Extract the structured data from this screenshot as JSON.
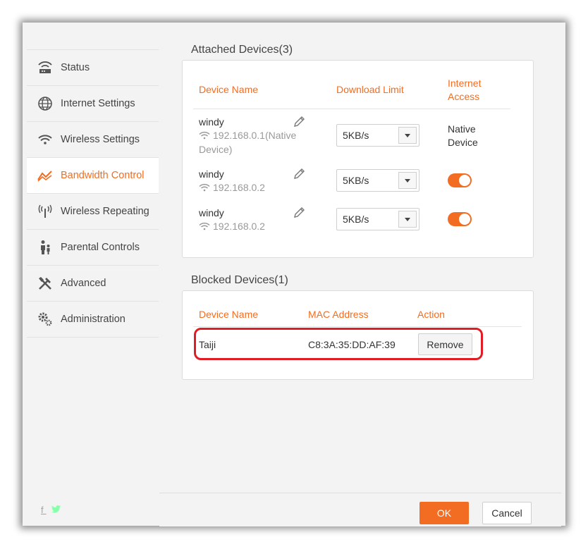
{
  "sidebar": {
    "items": [
      {
        "label": "Status",
        "icon": "router-icon"
      },
      {
        "label": "Internet Settings",
        "icon": "globe-icon"
      },
      {
        "label": "Wireless Settings",
        "icon": "wifi-icon"
      },
      {
        "label": "Bandwidth Control",
        "icon": "bandwidth-chart-icon",
        "active": true
      },
      {
        "label": "Wireless Repeating",
        "icon": "antenna-icon"
      },
      {
        "label": "Parental Controls",
        "icon": "family-icon"
      },
      {
        "label": "Advanced",
        "icon": "tools-icon"
      },
      {
        "label": "Administration",
        "icon": "gears-icon"
      }
    ],
    "social": [
      "facebook-icon",
      "twitter-icon"
    ],
    "social_text": "f"
  },
  "attached": {
    "title": "Attached Devices(3)",
    "headers": {
      "device_name": "Device Name",
      "download_limit": "Download Limit",
      "internet_access_1": "Internet",
      "internet_access_2": "Access"
    },
    "devices": [
      {
        "name": "windy",
        "ip_line1": "192.168.0.1(Native",
        "ip_line2": "Device)",
        "limit": "5KB/s",
        "access_line1": "Native",
        "access_line2": "Device"
      },
      {
        "name": "windy",
        "ip_line1": "192.168.0.2",
        "limit": "5KB/s",
        "access": "on"
      },
      {
        "name": "windy",
        "ip_line1": "192.168.0.2",
        "limit": "5KB/s",
        "access": "on"
      }
    ]
  },
  "blocked": {
    "title": "Blocked Devices(1)",
    "headers": {
      "device_name": "Device Name",
      "mac_address": "MAC Address",
      "action": "Action"
    },
    "rows": [
      {
        "name": "Taiji",
        "mac": "C8:3A:35:DD:AF:39",
        "action_label": "Remove"
      }
    ]
  },
  "footer": {
    "ok_label": "OK",
    "cancel_label": "Cancel"
  },
  "colors": {
    "accent": "#f26d21",
    "highlight": "#e11c24"
  }
}
